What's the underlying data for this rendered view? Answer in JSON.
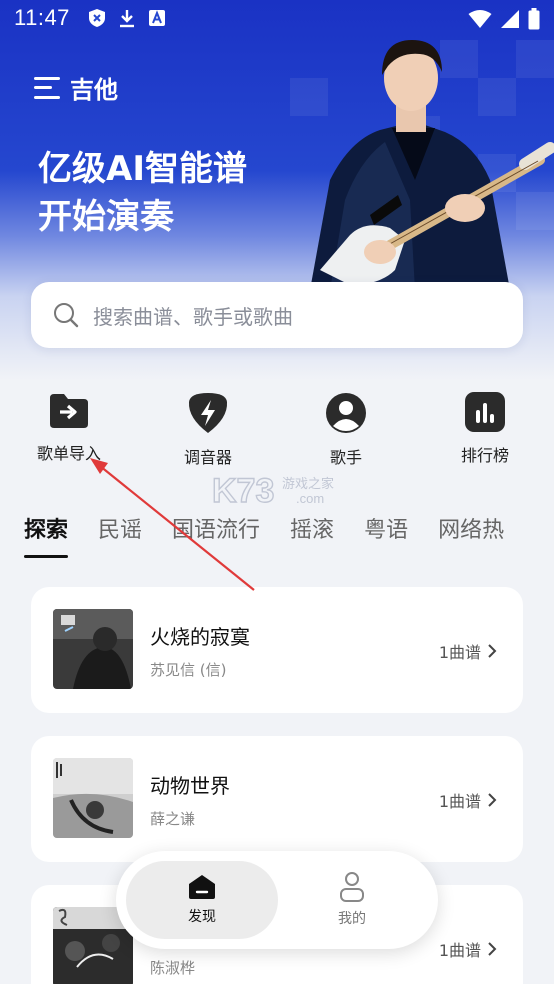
{
  "status_bar": {
    "time": "11:47",
    "icons": [
      "shield-icon",
      "download-icon",
      "font-icon"
    ],
    "right_icons": [
      "wifi-icon",
      "signal-icon",
      "battery-icon"
    ]
  },
  "app_bar": {
    "title": "吉他",
    "menu_icon": "menu-icon"
  },
  "hero": {
    "line1": "亿级AI智能谱",
    "line2": "开始演奏"
  },
  "search": {
    "placeholder": "搜索曲谱、歌手或歌曲",
    "icon": "search-icon"
  },
  "quick_actions": [
    {
      "label": "歌单导入",
      "icon": "folder-import-icon"
    },
    {
      "label": "调音器",
      "icon": "tuner-bolt-icon"
    },
    {
      "label": "歌手",
      "icon": "singer-icon"
    },
    {
      "label": "排行榜",
      "icon": "chart-icon"
    }
  ],
  "tabs": [
    "探索",
    "民谣",
    "国语流行",
    "摇滚",
    "粤语",
    "网络热"
  ],
  "active_tab": "探索",
  "songs": [
    {
      "title": "火烧的寂寞",
      "artist": "苏见信 (信)",
      "count": "1曲谱"
    },
    {
      "title": "动物世界",
      "artist": "薛之谦",
      "count": "1曲谱"
    },
    {
      "title": "",
      "artist": "陈淑桦",
      "count": "1曲谱"
    }
  ],
  "bottom_nav": [
    {
      "label": "发现",
      "icon": "discover-icon",
      "active": true
    },
    {
      "label": "我的",
      "icon": "profile-icon",
      "active": false
    }
  ],
  "watermark": {
    "logo": "K73",
    "subtitle": "游戏之家",
    "domain": ".com"
  },
  "colors": {
    "hero_blue": "#1a32c4",
    "background": "#f1f3f7",
    "arrow_red": "#e03a3a"
  }
}
